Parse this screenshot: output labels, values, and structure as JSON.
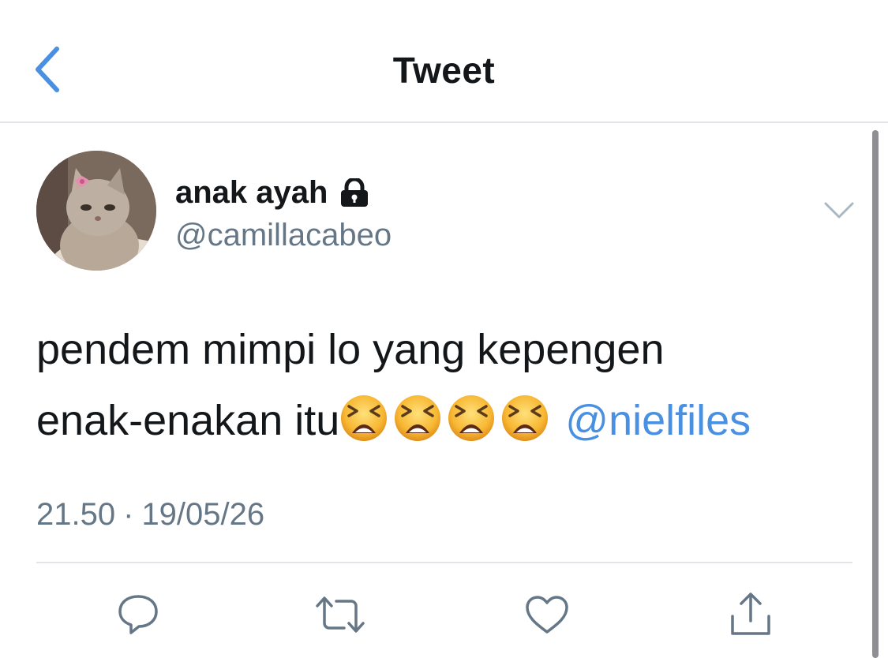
{
  "nav": {
    "title": "Tweet",
    "back_icon": "chevron-left-icon"
  },
  "tweet": {
    "author": {
      "display_name": "anak ayah",
      "handle": "@camillacabeo",
      "protected_icon": "lock-icon",
      "avatar": "cat-avatar"
    },
    "text_line1": "pendem mimpi lo yang kepengen",
    "text_line2": "enak-enakan itu",
    "emoji_name": "tired-face-emoji",
    "emoji_count": 4,
    "mention": "@nielfiles",
    "time": "21.50",
    "separator": "·",
    "date": "19/05/26"
  },
  "actions": [
    "reply-icon",
    "retweet-icon",
    "like-icon",
    "share-icon"
  ],
  "colors": {
    "accent": "#4a90e2",
    "text": "#14171a",
    "secondary": "#657786",
    "divider": "#e1e4e8"
  }
}
